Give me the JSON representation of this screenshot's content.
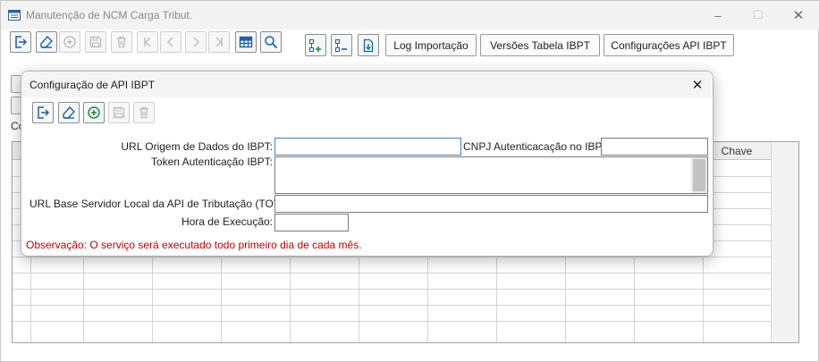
{
  "window": {
    "title": "Manutenção de NCM Carga Tribut.",
    "controls": {
      "minimize": "–",
      "maximize": "☐",
      "close": "✕"
    }
  },
  "toolbar": {
    "icon_buttons": [
      {
        "icon": "exit-icon",
        "enabled": true
      },
      {
        "icon": "eraser-icon",
        "enabled": true
      },
      {
        "icon": "add-circle-icon",
        "enabled": false
      },
      {
        "icon": "save-icon",
        "enabled": false
      },
      {
        "icon": "trash-icon",
        "enabled": false
      },
      {
        "icon": "first-record-icon",
        "enabled": false
      },
      {
        "icon": "previous-icon",
        "enabled": false
      },
      {
        "icon": "next-icon",
        "enabled": false
      },
      {
        "icon": "last-record-icon",
        "enabled": false
      },
      {
        "icon": "table-icon",
        "enabled": true
      },
      {
        "icon": "search-icon",
        "enabled": true
      },
      {
        "icon": "expand-tree-icon",
        "enabled": true
      },
      {
        "icon": "collapse-tree-icon",
        "enabled": true
      },
      {
        "icon": "import-file-icon",
        "enabled": true
      }
    ],
    "log_importacao": "Log Importação",
    "versoes_tabela": "Versões Tabela IBPT",
    "config_api": "Configurações API IBPT"
  },
  "background": {
    "partial_label": "Co",
    "grid": {
      "header_visible": "Chave",
      "rows": 10,
      "columns": 11
    }
  },
  "dialog": {
    "title": "Configuração de API IBPT",
    "close": "✕",
    "buttons": [
      {
        "icon": "exit-icon",
        "enabled": true
      },
      {
        "icon": "eraser-icon",
        "enabled": true
      },
      {
        "icon": "add-circle-icon",
        "enabled": true
      },
      {
        "icon": "save-icon",
        "enabled": false
      },
      {
        "icon": "trash-icon",
        "enabled": false
      }
    ],
    "fields": {
      "url_origem_label": "URL Origem de Dados do IBPT:",
      "url_origem_value": "",
      "cnpj_label": "CNPJ Autenticacação no IBPT:",
      "cnpj_value": "",
      "token_label": "Token Autenticação IBPT:",
      "token_value": "",
      "url_base_label": "URL Base Servidor Local da API de Tributação (TOTVS):",
      "url_base_value": "",
      "hora_label": "Hora de Execução:",
      "hora_value": ""
    },
    "observacao": "Observação: O serviço será executado todo primeiro dia de cada mês."
  },
  "colors": {
    "accent_green": "#1e8a3c",
    "accent_blue": "#1f5fa8",
    "observation_red": "#c00000"
  }
}
